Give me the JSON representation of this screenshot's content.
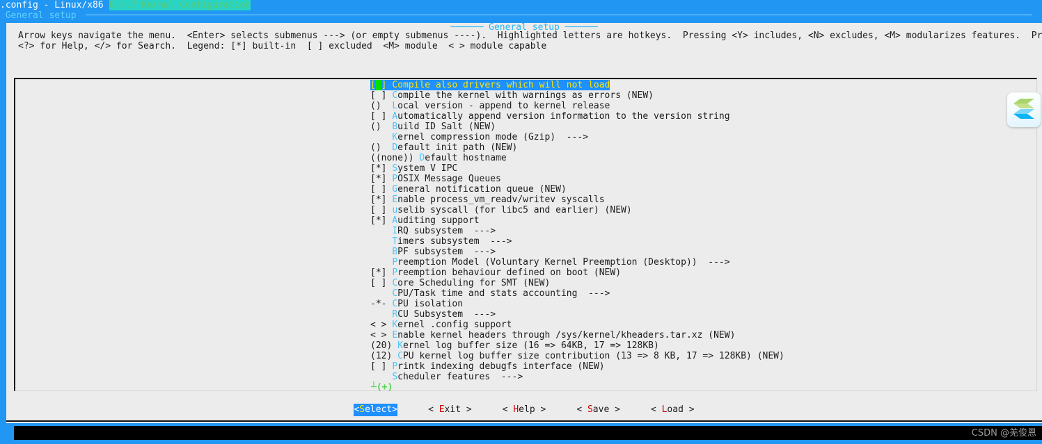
{
  "titlebar": {
    "prefix": ".config - Linux/x86 ",
    "version_highlight": "6.4.7 Kernel Configuration"
  },
  "window": {
    "caption": " General setup "
  },
  "dialog": {
    "panel_title": "General setup",
    "help_line1": "Arrow keys navigate the menu.  <Enter> selects submenus ---> (or empty submenus ----).  Highlighted letters are hotkeys.  Pressing <Y> includes, <N> excludes, <M> modularizes features.  Press <Esc><Esc> to exit,",
    "help_line2": "<?> for Help, </> for Search.  Legend: [*] built-in  [ ] excluded  <M> module  < > module capable",
    "scroll_indicator": "┴(+)"
  },
  "menu": {
    "selected_index": 0,
    "items": [
      {
        "prefix": "[",
        "cursor": " ",
        "prefix_end": "] ",
        "hotkey": "C",
        "text": "ompile also drivers which will not load",
        "selected": true
      },
      {
        "prefix": "[ ] ",
        "hotkey": "C",
        "text": "ompile the kernel with warnings as errors (NEW)"
      },
      {
        "prefix": "()  ",
        "hotkey": "L",
        "text": "ocal version - append to kernel release"
      },
      {
        "prefix": "[ ] ",
        "hotkey": "A",
        "text": "utomatically append version information to the version string"
      },
      {
        "prefix": "()  ",
        "hotkey": "B",
        "text": "uild ID Salt (NEW)"
      },
      {
        "prefix": "    ",
        "hotkey": "K",
        "text": "ernel compression mode (Gzip)  --->"
      },
      {
        "prefix": "()  ",
        "hotkey": "D",
        "text": "efault init path (NEW)"
      },
      {
        "prefix": "((none)) ",
        "hotkey": "D",
        "text": "efault hostname"
      },
      {
        "prefix": "[*] ",
        "hotkey": "S",
        "text": "ystem V IPC"
      },
      {
        "prefix": "[*] ",
        "hotkey": "P",
        "text": "OSIX Message Queues"
      },
      {
        "prefix": "[ ] ",
        "hotkey": "G",
        "text": "eneral notification queue (NEW)"
      },
      {
        "prefix": "[*] ",
        "hotkey": "E",
        "text": "nable process_vm_readv/writev syscalls"
      },
      {
        "prefix": "[ ] ",
        "hotkey": "u",
        "text": "selib syscall (for libc5 and earlier) (NEW)"
      },
      {
        "prefix": "[*] ",
        "hotkey": "A",
        "text": "uditing support"
      },
      {
        "prefix": "    ",
        "hotkey": "I",
        "text": "RQ subsystem  --->"
      },
      {
        "prefix": "    ",
        "hotkey": "T",
        "text": "imers subsystem  --->"
      },
      {
        "prefix": "    ",
        "hotkey": "B",
        "text": "PF subsystem  --->"
      },
      {
        "prefix": "    ",
        "hotkey": "P",
        "text": "reemption Model (Voluntary Kernel Preemption (Desktop))  --->"
      },
      {
        "prefix": "[*] ",
        "hotkey": "P",
        "text": "reemption behaviour defined on boot (NEW)"
      },
      {
        "prefix": "[ ] ",
        "hotkey": "C",
        "text": "ore Scheduling for SMT (NEW)"
      },
      {
        "prefix": "    ",
        "hotkey": "C",
        "text": "PU/Task time and stats accounting  --->"
      },
      {
        "prefix": "-*- ",
        "hotkey": "C",
        "text": "PU isolation"
      },
      {
        "prefix": "    ",
        "hotkey": "R",
        "text": "CU Subsystem  --->"
      },
      {
        "prefix": "< > ",
        "hotkey": "K",
        "text": "ernel .config support"
      },
      {
        "prefix": "< > ",
        "hotkey": "E",
        "text": "nable kernel headers through /sys/kernel/kheaders.tar.xz (NEW)"
      },
      {
        "prefix": "(20) ",
        "hotkey": "K",
        "text": "ernel log buffer size (16 => 64KB, 17 => 128KB)"
      },
      {
        "prefix": "(12) ",
        "hotkey": "C",
        "text": "PU kernel log buffer size contribution (13 => 8 KB, 17 => 128KB) (NEW)"
      },
      {
        "prefix": "[ ] ",
        "hotkey": "P",
        "text": "rintk indexing debugfs interface (NEW)"
      },
      {
        "prefix": "    ",
        "hotkey": "S",
        "text": "cheduler features  --->"
      }
    ]
  },
  "buttons": [
    {
      "left": "<",
      "hotkey": "S",
      "rest": "elect",
      "right": ">",
      "active": true
    },
    {
      "left": "< ",
      "hotkey": "E",
      "rest": "xit",
      "right": " >",
      "active": false
    },
    {
      "left": "< ",
      "hotkey": "H",
      "rest": "elp",
      "right": " >",
      "active": false
    },
    {
      "left": "< ",
      "hotkey": "S",
      "rest": "ave",
      "right": " >",
      "active": false
    },
    {
      "left": "< ",
      "hotkey": "L",
      "rest": "oad",
      "right": " >",
      "active": false
    }
  ],
  "watermark": {
    "text": "CSDN @羌俊恩"
  },
  "colors": {
    "backdrop_blue": "#2196f3",
    "panel_grey": "#ececec",
    "highlight_blue": "#1e90ff",
    "highlight_text": "#ffe600",
    "hotkey_blue": "#4fc3f7",
    "button_hotkey_red": "#cc0000",
    "cursor_green": "#00e000",
    "version_bg": "#2ad4c4"
  }
}
